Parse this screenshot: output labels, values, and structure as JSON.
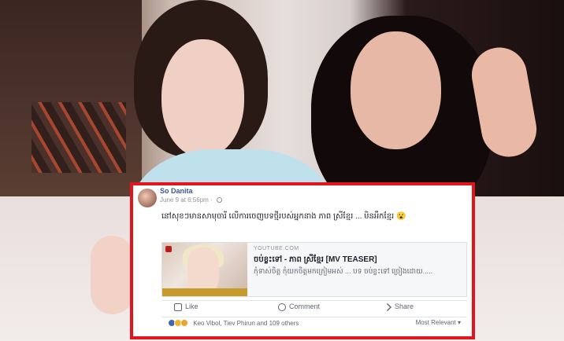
{
  "post": {
    "author": "So Danita",
    "time": "June 9 at 6:56pm · ",
    "body": "នៅសុខៗមានសាមុចារី លើការចេញបទថ្មីរបស់អ្នកនាង ភាព ស្រីខ្មែរ ... មិនអឹកខ្មែរ 😮",
    "link": {
      "source": "YOUTUBE.COM",
      "title": "ចប់ខ្លះទៅ - ភាព ស្រីខ្មែរ [MV TEASER]",
      "description": "កុំទាស់ចិត្ត កុំយកចិត្តមកក្រៀមអស់ ... បទ ចប់ខ្លះទៅ ច្រៀងដោយ....."
    },
    "actions": {
      "like": "Like",
      "comment": "Comment",
      "share": "Share"
    },
    "reactions": {
      "names": "Keo Vibol, Tiev Phirun and 109 others",
      "sort": "Most Relevant ▾"
    }
  },
  "colors": {
    "highlight": "#e3141b",
    "link_blue": "#365899"
  }
}
